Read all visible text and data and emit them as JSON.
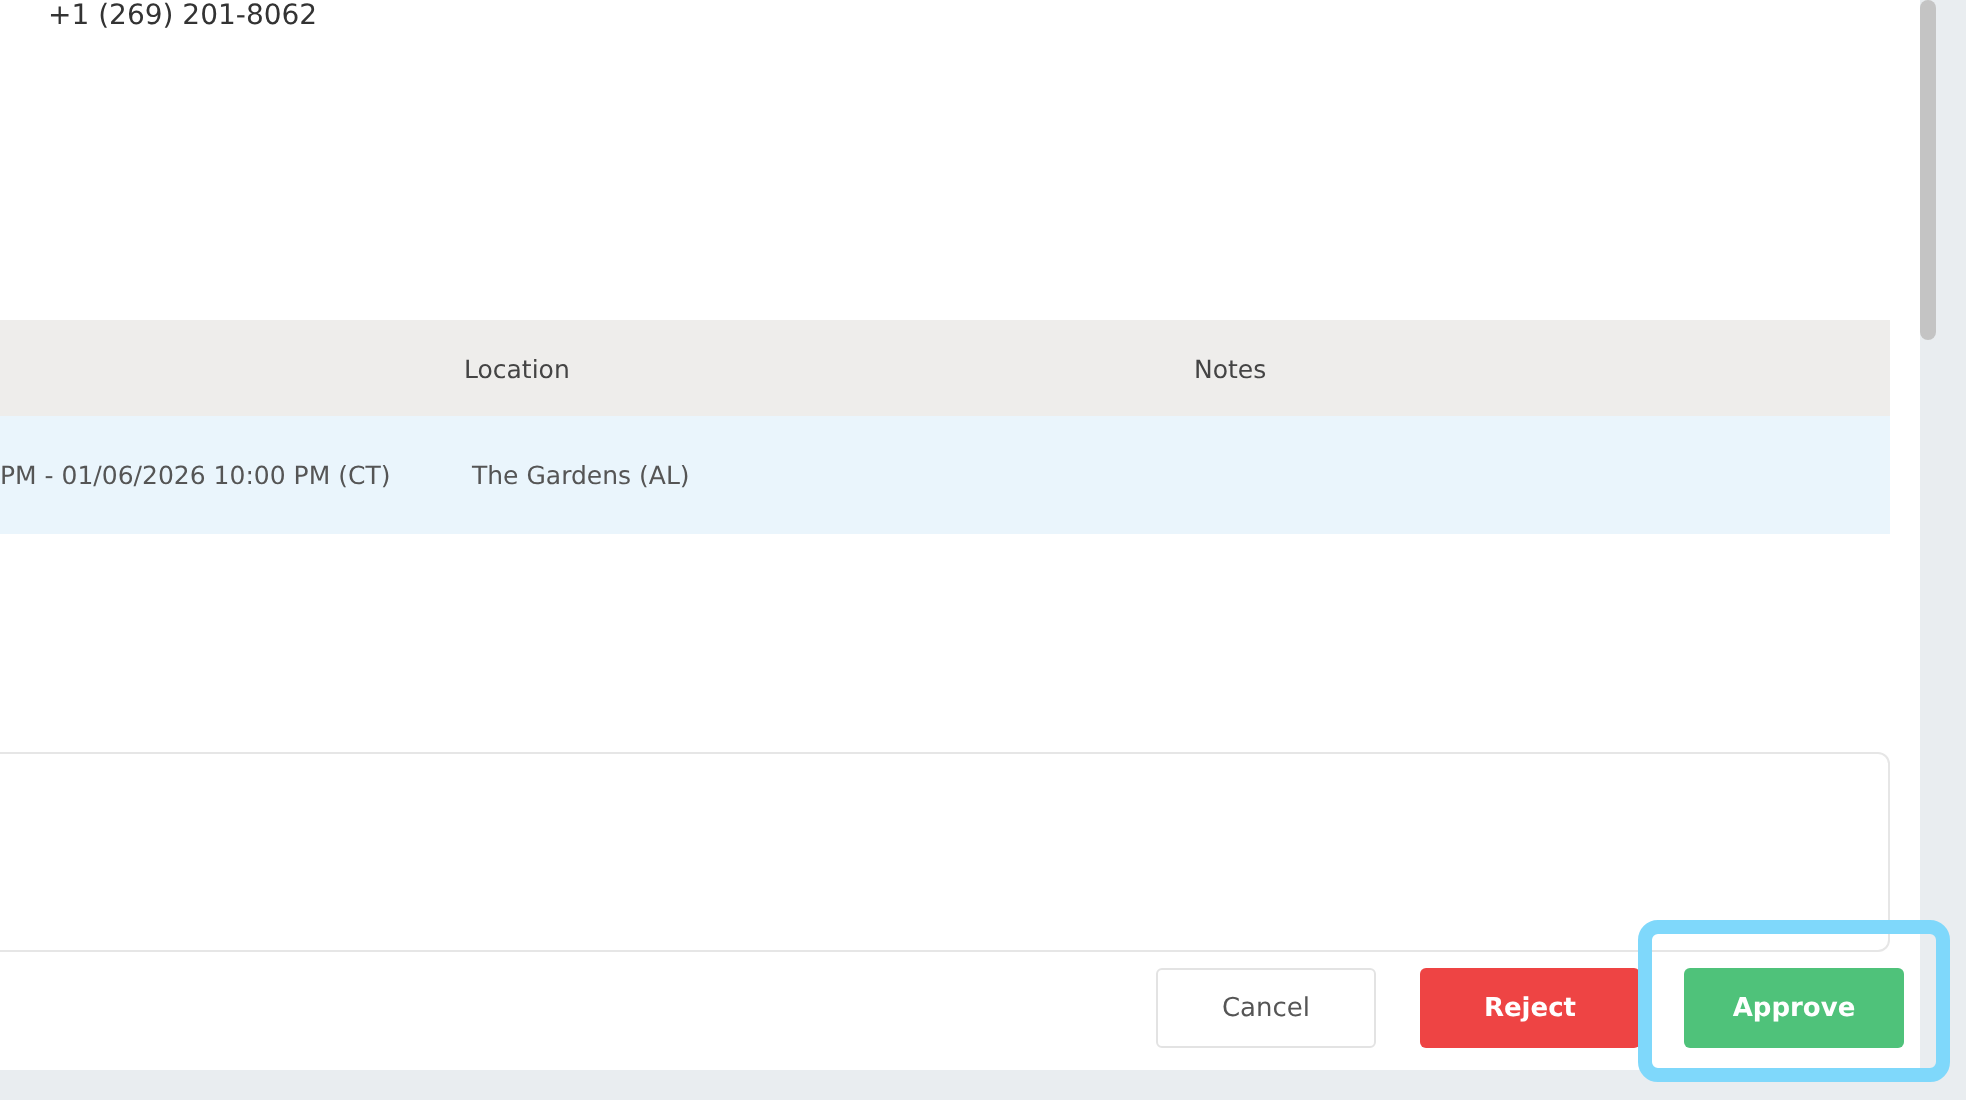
{
  "contact": {
    "phone": "+1 (269) 201-8062"
  },
  "table": {
    "columns": [
      {
        "label": "Location"
      },
      {
        "label": "Notes"
      }
    ],
    "rows": [
      {
        "column_1": "PM - 01/06/2026 10:00 PM (CT)",
        "location": "The Gardens (AL)",
        "selected": true
      }
    ]
  },
  "buttons": [
    {
      "label": "Cancel",
      "kind": "secondary",
      "highlighted": false
    },
    {
      "label": "Reject",
      "kind": "danger",
      "highlighted": false
    },
    {
      "label": "Approve",
      "kind": "primary",
      "highlighted": true
    }
  ]
}
